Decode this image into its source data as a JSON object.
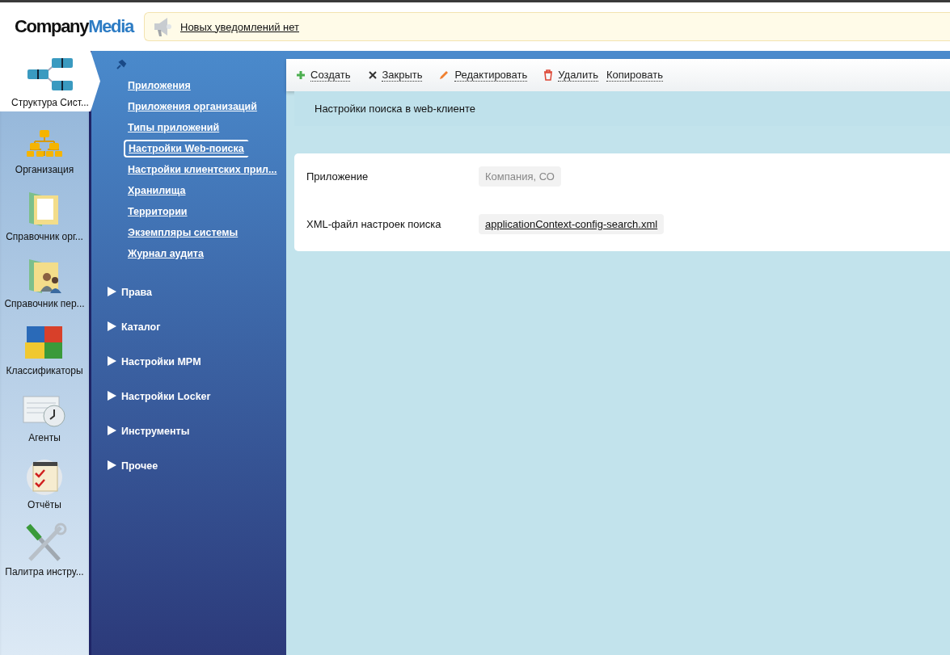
{
  "header": {
    "logo": {
      "part1": "Company",
      "part2": "Media"
    },
    "notification": "Новых уведомлений нет"
  },
  "rail": [
    {
      "label": "Структура Сист...",
      "selected": true
    },
    {
      "label": "Организация",
      "selected": false
    },
    {
      "label": "Справочник орг...",
      "selected": false
    },
    {
      "label": "Справочник пер...",
      "selected": false
    },
    {
      "label": "Классификаторы",
      "selected": false
    },
    {
      "label": "Агенты",
      "selected": false
    },
    {
      "label": "Отчёты",
      "selected": false
    },
    {
      "label": "Палитра инстру...",
      "selected": false
    }
  ],
  "nav": {
    "links": [
      {
        "label": "Приложения",
        "selected": false
      },
      {
        "label": "Приложения организаций",
        "selected": false
      },
      {
        "label": "Типы приложений",
        "selected": false
      },
      {
        "label": "Настройки Web-поиска",
        "selected": true
      },
      {
        "label": "Настройки клиентских прил...",
        "selected": false
      },
      {
        "label": "Хранилища",
        "selected": false
      },
      {
        "label": "Территории",
        "selected": false
      },
      {
        "label": "Экземпляры системы",
        "selected": false
      },
      {
        "label": "Журнал аудита",
        "selected": false
      }
    ],
    "sections": [
      {
        "label": "Права",
        "expanded": false
      },
      {
        "label": "Каталог",
        "expanded": false
      },
      {
        "label": "Настройки MPM",
        "expanded": false
      },
      {
        "label": "Настройки Locker",
        "expanded": false
      },
      {
        "label": "Инструменты",
        "expanded": false
      },
      {
        "label": "Прочее",
        "expanded": false
      }
    ]
  },
  "toolbar": [
    {
      "kind": "create",
      "label": "Создать"
    },
    {
      "kind": "close",
      "label": "Закрыть"
    },
    {
      "kind": "edit",
      "label": "Редактировать"
    },
    {
      "kind": "delete",
      "label": "Удалить"
    },
    {
      "kind": "copy",
      "label": "Копировать"
    }
  ],
  "content": {
    "title": "Настройки поиска в web-клиенте",
    "fields": [
      {
        "label": "Приложение",
        "value": "Компания, СО",
        "kind": "readonly"
      },
      {
        "label": "XML-файл настроек поиска",
        "value": "applicationContext-config-search.xml",
        "kind": "link"
      }
    ]
  }
}
